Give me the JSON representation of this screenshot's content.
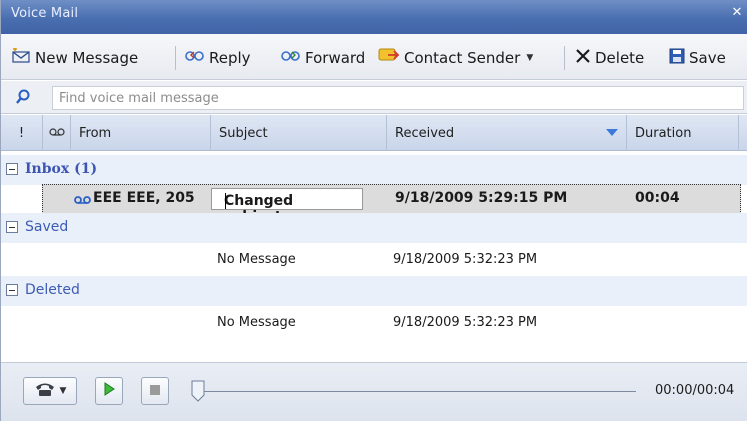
{
  "window": {
    "title": "Voice Mail"
  },
  "toolbar": {
    "new_message": "New Message",
    "reply": "Reply",
    "forward": "Forward",
    "contact_sender": "Contact Sender",
    "delete": "Delete",
    "save": "Save"
  },
  "search": {
    "placeholder": "Find voice mail message"
  },
  "columns": {
    "flag": "!",
    "from": "From",
    "subject": "Subject",
    "received": "Received",
    "duration": "Duration"
  },
  "groups": {
    "inbox": {
      "label": "Inbox (1)",
      "rows": [
        {
          "from": "EEE EEE, 205",
          "subject": "Changed subject",
          "received": "9/18/2009 5:29:15 PM",
          "duration": "00:04"
        }
      ]
    },
    "saved": {
      "label": "Saved",
      "rows": [
        {
          "subject": "No Message",
          "received": "9/18/2009 5:32:23 PM"
        }
      ]
    },
    "deleted": {
      "label": "Deleted",
      "rows": [
        {
          "subject": "No Message",
          "received": "9/18/2009 5:32:23 PM"
        }
      ]
    }
  },
  "player": {
    "time": "00:00/00:04",
    "position": 0
  },
  "colors": {
    "titlebar": "#4a6fb0",
    "group_text": "#3b5bb5",
    "accent": "#3b7ad8"
  }
}
